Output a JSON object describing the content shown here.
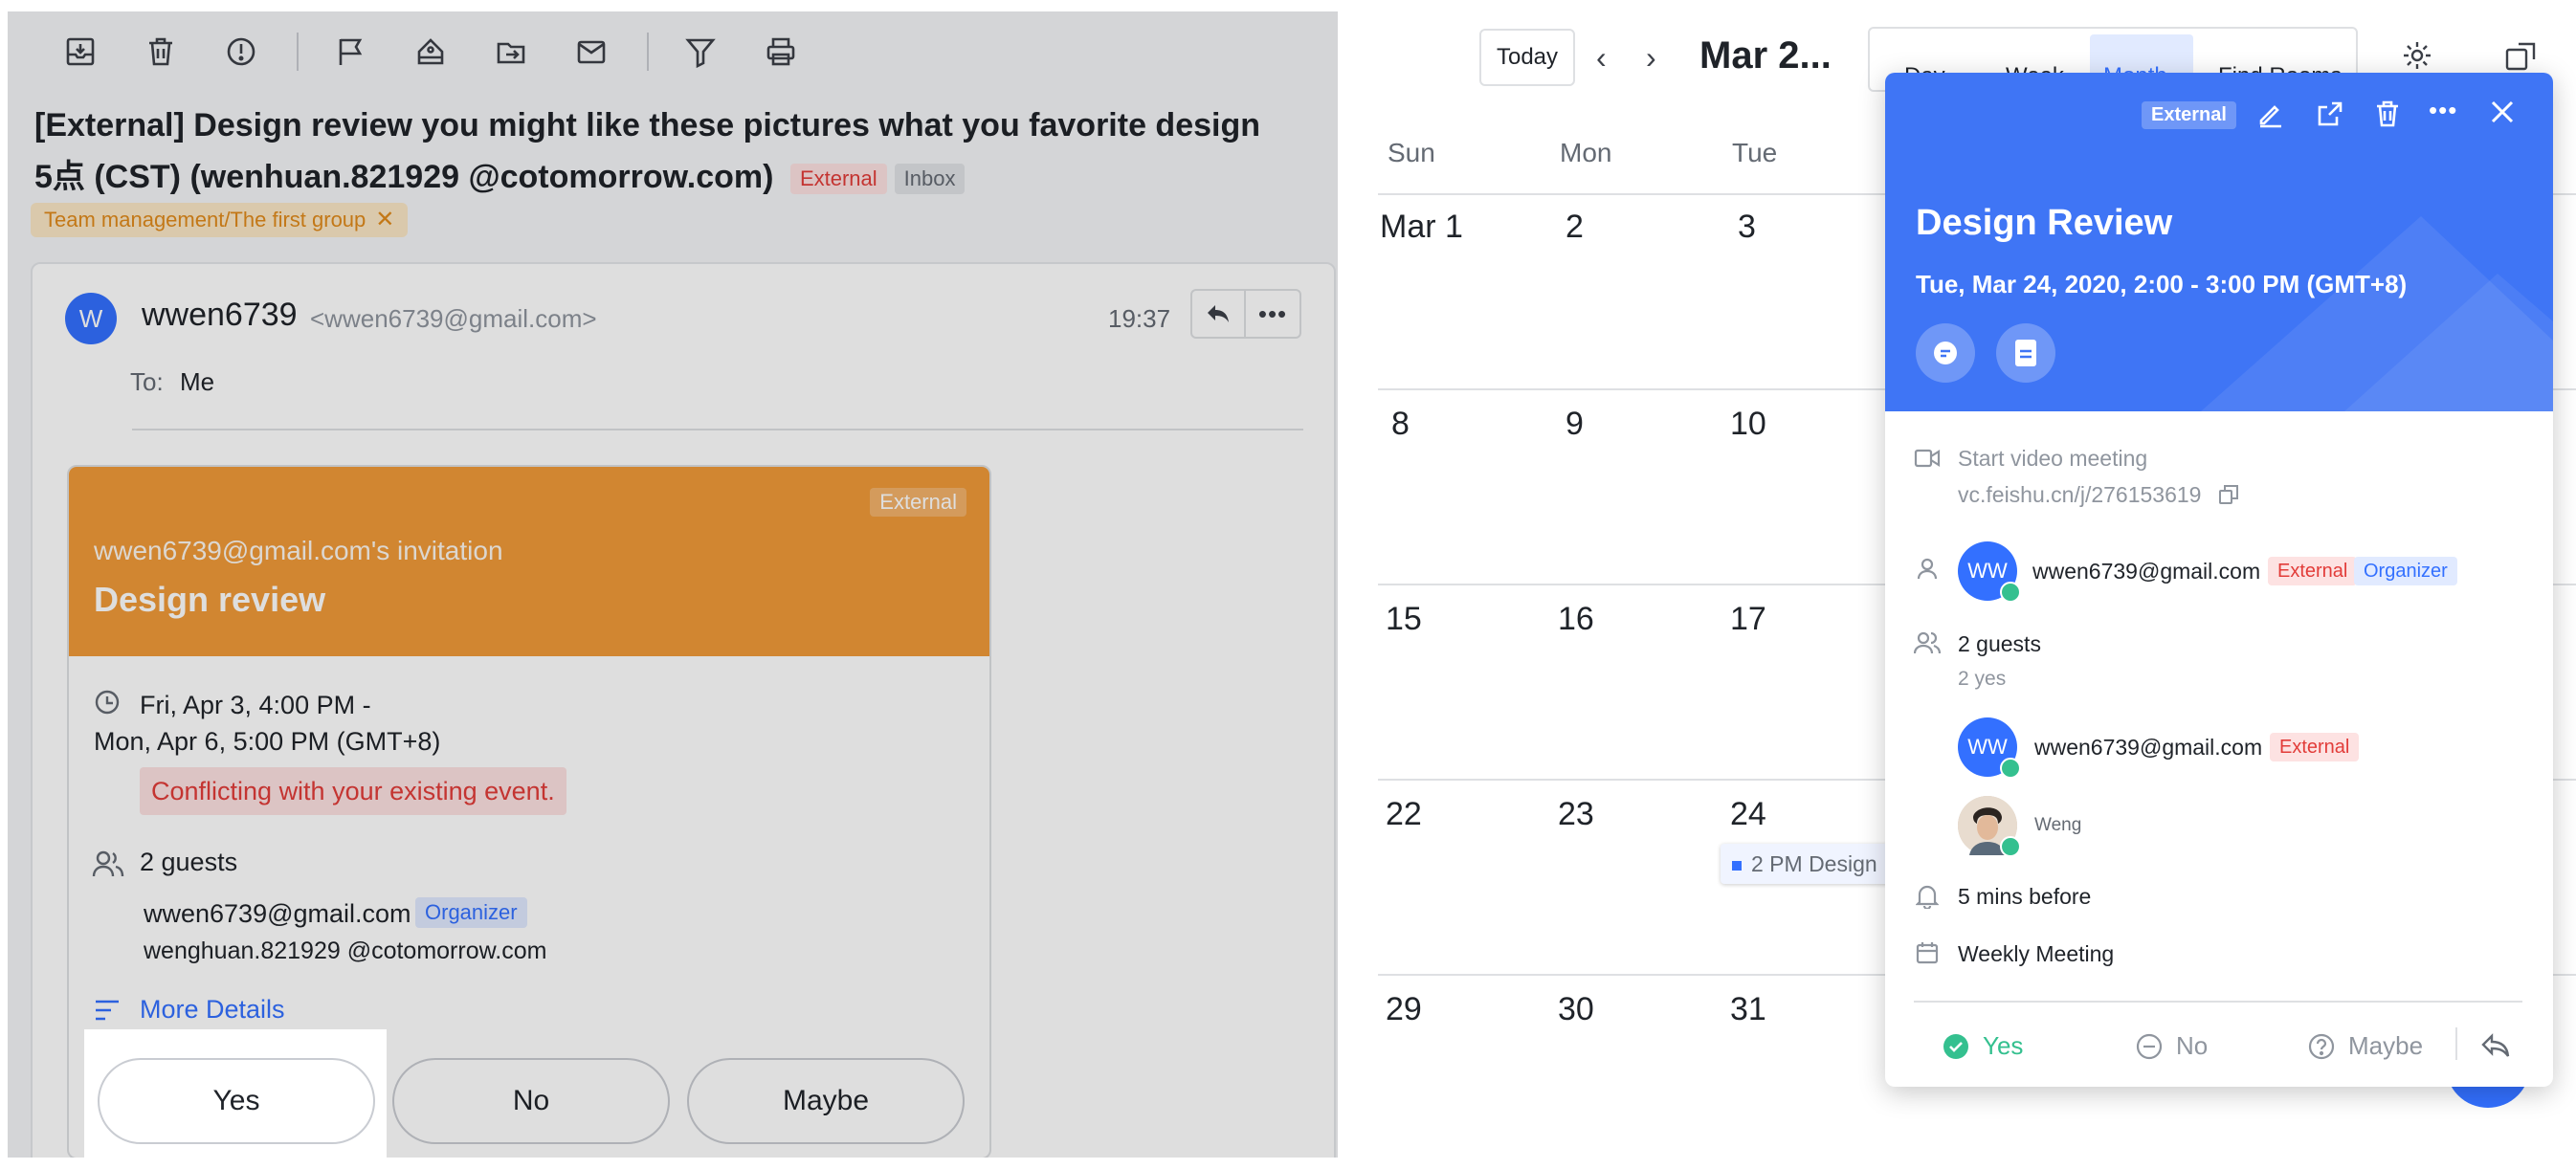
{
  "email": {
    "toolbar": {
      "icons": [
        "archive-icon",
        "delete-icon",
        "spam-icon",
        "flag-icon",
        "label-icon",
        "move-icon",
        "mark-unread-icon",
        "filter-icon",
        "print-icon"
      ]
    },
    "subject": {
      "prefix": "[External]  Design review",
      "body": " you might like these pictures what you favorite design",
      "line2": "5点 (CST) (wenhuan.821929 @cotomorrow.com)",
      "tag_external": "External",
      "tag_inbox": "Inbox"
    },
    "label_chip": "Team management/The first group",
    "sender": {
      "avatar_letter": "W",
      "name": "wwen6739",
      "address": "<wwen6739@gmail.com>",
      "time": "19:37",
      "to_label": "To:",
      "to_value": "Me"
    },
    "invitation": {
      "external_tag": "External",
      "from_line": "wwen6739@gmail.com's invitation",
      "title": "Design review",
      "time_line1": "Fri, Apr 3, 4:00 PM -",
      "time_line2": "Mon, Apr 6, 5:00 PM (GMT+8)",
      "conflict": "Conflicting with your existing event.",
      "guests_label": "2 guests",
      "guest1": "wwen6739@gmail.com",
      "guest1_tag": "Organizer",
      "guest2": "wenghuan.821929 @cotomorrow.com",
      "more_details": "More Details",
      "btn_yes": "Yes",
      "btn_no": "No",
      "btn_maybe": "Maybe"
    }
  },
  "calendar": {
    "today_btn": "Today",
    "month_title": "Mar 2...",
    "views": [
      "Day",
      "Week",
      "Month",
      "Find Rooms"
    ],
    "active_view": "Month",
    "weekdays": [
      "Sun",
      "Mon",
      "Tue"
    ],
    "weeks": [
      [
        "Mar 1",
        "2",
        "3"
      ],
      [
        "8",
        "9",
        "10"
      ],
      [
        "15",
        "16",
        "17"
      ],
      [
        "22",
        "23",
        "24"
      ],
      [
        "29",
        "30",
        "31"
      ]
    ],
    "event_chip": "2 PM Design",
    "accent": "#3370ff"
  },
  "event": {
    "header_tag": "External",
    "title": "Design Review",
    "datetime": "Tue, Mar 24, 2020, 2:00 - 3:00 PM (GMT+8)",
    "video_label": "Start video meeting",
    "video_link": "vc.feishu.cn/j/276153619",
    "organizer_initials": "WW",
    "organizer_email": "wwen6739@gmail.com",
    "organizer_tag_external": "External",
    "organizer_tag_role": "Organizer",
    "guests_count": "2 guests",
    "guests_yes": "2 yes",
    "guest1_initials": "WW",
    "guest1_email": "wwen6739@gmail.com",
    "guest1_tag": "External",
    "guest2_name": "Weng",
    "reminder": "5 mins before",
    "calendar_name": "Weekly Meeting",
    "rsvp_yes": "Yes",
    "rsvp_no": "No",
    "rsvp_maybe": "Maybe",
    "header_color": "#3f75f5"
  }
}
